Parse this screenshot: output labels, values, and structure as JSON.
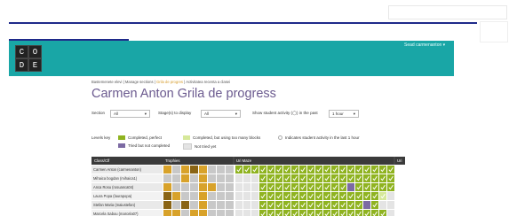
{
  "header": {
    "logo_letters": [
      "C",
      "O",
      "D",
      "E"
    ],
    "user_menu": "Sead carmenanton ▾",
    "brand_color": "#19a6a6"
  },
  "breadcrumb": {
    "item1": "Bastemenete elevi",
    "item2": "Manage sections",
    "item3": "Grila de progres",
    "item4": "Activitatea recenta a clasei",
    "sep": "|"
  },
  "page_title": "Carmen Anton Grila de progress",
  "filters": {
    "section_label": "Section",
    "section_value": "All",
    "stage_label": "Stage(s) to display",
    "stage_value": "All",
    "activity_label": "Show student activity (◯) in the past",
    "activity_value": "1 hour"
  },
  "levels_key": {
    "title": "Levels key",
    "perfect": "Completed, perfect",
    "too_many": "Completed, but using too many blocks",
    "activity": "Indicates student activity in the last 1 hour",
    "tried": "Tried but not completed",
    "not_tried": "Not tried yet"
  },
  "colors": {
    "perfect": "#8fb320",
    "too_many": "#d6e89a",
    "tried": "#7c6aa3",
    "not_tried": "#e4e4e4",
    "trophy_gold": "#d8a22a",
    "trophy_brown": "#8a6414",
    "trophy_silver": "#c8c8c8"
  },
  "table": {
    "headers": [
      "Class/Clf",
      "Trophies",
      "Uri Maze",
      "Uri"
    ],
    "students": [
      "Carmen Anton (carmenanton)",
      "Mihaica bogdan (mihaica1)",
      "Anca Rosu (rosuanca04)",
      "Laura Popa (laurapopa)",
      "Stefan Maria (maiustefan)",
      "Marcela Sabou (marcela07)"
    ],
    "trophies": [
      [
        "gold",
        "silver",
        "gold",
        "brown",
        "gold",
        "silver",
        "silver",
        "silver"
      ],
      [
        "silver",
        "silver",
        "gold",
        "silver",
        "gold",
        "silver",
        "silver",
        "silver"
      ],
      [
        "gold",
        "silver",
        "silver",
        "silver",
        "gold",
        "gold",
        "silver",
        "silver"
      ],
      [
        "brown",
        "gold",
        "silver",
        "silver",
        "gold",
        "silver",
        "silver",
        "silver"
      ],
      [
        "brown",
        "silver",
        "brown",
        "silver",
        "gold",
        "silver",
        "silver",
        "silver"
      ],
      [
        "gold",
        "gold",
        "silver",
        "gold",
        "gold",
        "silver",
        "silver",
        "silver"
      ]
    ],
    "levels": [
      [
        "P",
        "P",
        "P",
        "P",
        "P",
        "P",
        "P",
        "P",
        "P",
        "P",
        "P",
        "P",
        "P",
        "P",
        "P",
        "P",
        "P",
        "P",
        "P",
        "P"
      ],
      [
        "N",
        "N",
        "N",
        "P",
        "P",
        "P",
        "P",
        "P",
        "P",
        "P",
        "P",
        "P",
        "P",
        "P",
        "P",
        "P",
        "P",
        "P",
        "P",
        "P"
      ],
      [
        "N",
        "N",
        "N",
        "P",
        "P",
        "P",
        "P",
        "P",
        "P",
        "P",
        "P",
        "P",
        "P",
        "P",
        "T",
        "P",
        "P",
        "P",
        "P",
        "P"
      ],
      [
        "N",
        "N",
        "N",
        "P",
        "P",
        "P",
        "P",
        "P",
        "P",
        "P",
        "P",
        "P",
        "P",
        "P",
        "P",
        "P",
        "P",
        "P",
        "B",
        "N"
      ],
      [
        "N",
        "N",
        "N",
        "P",
        "P",
        "P",
        "P",
        "P",
        "P",
        "P",
        "P",
        "P",
        "P",
        "P",
        "P",
        "P",
        "T",
        "P",
        "N",
        "N"
      ],
      [
        "N",
        "N",
        "N",
        "P",
        "P",
        "P",
        "P",
        "P",
        "P",
        "P",
        "P",
        "P",
        "P",
        "P",
        "P",
        "P",
        "P",
        "P",
        "P",
        "N"
      ]
    ]
  }
}
